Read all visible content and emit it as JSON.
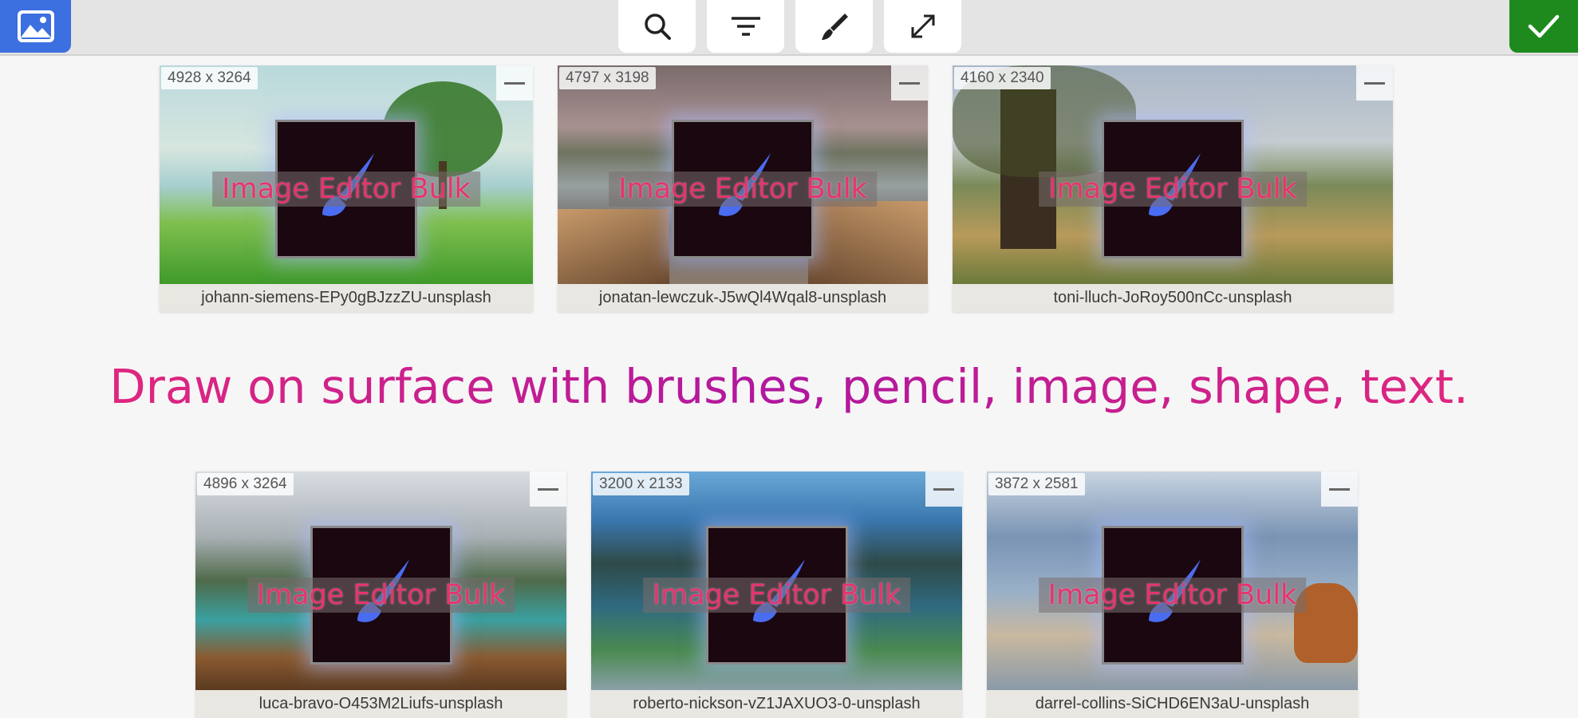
{
  "toolbar": {
    "app_icon": "image-gallery-icon",
    "buttons": [
      {
        "name": "search-button",
        "icon": "search-icon"
      },
      {
        "name": "filter-button",
        "icon": "filter-icon"
      },
      {
        "name": "brush-button",
        "icon": "brush-icon"
      },
      {
        "name": "resize-button",
        "icon": "expand-icon"
      }
    ],
    "confirm_icon": "checkmark-icon",
    "confirm_color": "#1e8a1e",
    "accent_color": "#3c6fe0"
  },
  "watermark": {
    "text": "Image Editor Bulk",
    "color": "#e8336e"
  },
  "headline": "Draw on surface with brushes, pencil, image, shape, text.",
  "images": [
    {
      "dims": "4928 x 3264",
      "filename": "johann-siemens-EPy0gBJzzZU-unsplash"
    },
    {
      "dims": "4797 x 3198",
      "filename": "jonatan-lewczuk-J5wQl4Wqal8-unsplash"
    },
    {
      "dims": "4160 x 2340",
      "filename": "toni-lluch-JoRoy500nCc-unsplash"
    },
    {
      "dims": "4896 x 3264",
      "filename": "luca-bravo-O453M2Liufs-unsplash"
    },
    {
      "dims": "3200 x 2133",
      "filename": "roberto-nickson-vZ1JAXUO3-0-unsplash"
    },
    {
      "dims": "3872 x 2581",
      "filename": "darrel-collins-SiCHD6EN3aU-unsplash"
    }
  ]
}
